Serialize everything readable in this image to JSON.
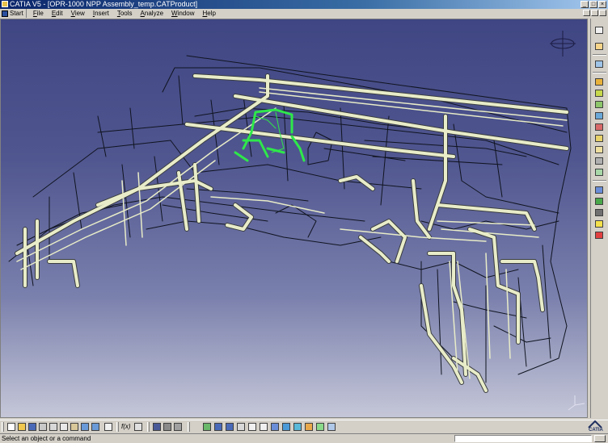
{
  "window": {
    "title": "CATIA V5 - [OPR-1000 NPP Assembly_temp.CATProduct]",
    "minimize_glyph": "_",
    "maximize_glyph": "□",
    "close_glyph": "×"
  },
  "menu": {
    "start": "Start",
    "items": [
      "File",
      "Edit",
      "View",
      "Insert",
      "Tools",
      "Analyze",
      "Window",
      "Help"
    ]
  },
  "toolbar": {
    "formula_label": "f(x)"
  },
  "status": {
    "message": "Select an object or a command"
  },
  "logo": {
    "text": "CATIA"
  },
  "colors": {
    "pipe_white": "#e8ecc8",
    "pipe_green": "#2ee84a",
    "pipe_dark": "#101420",
    "background_top": "#3f4683",
    "background_bottom": "#c5c7d8"
  }
}
